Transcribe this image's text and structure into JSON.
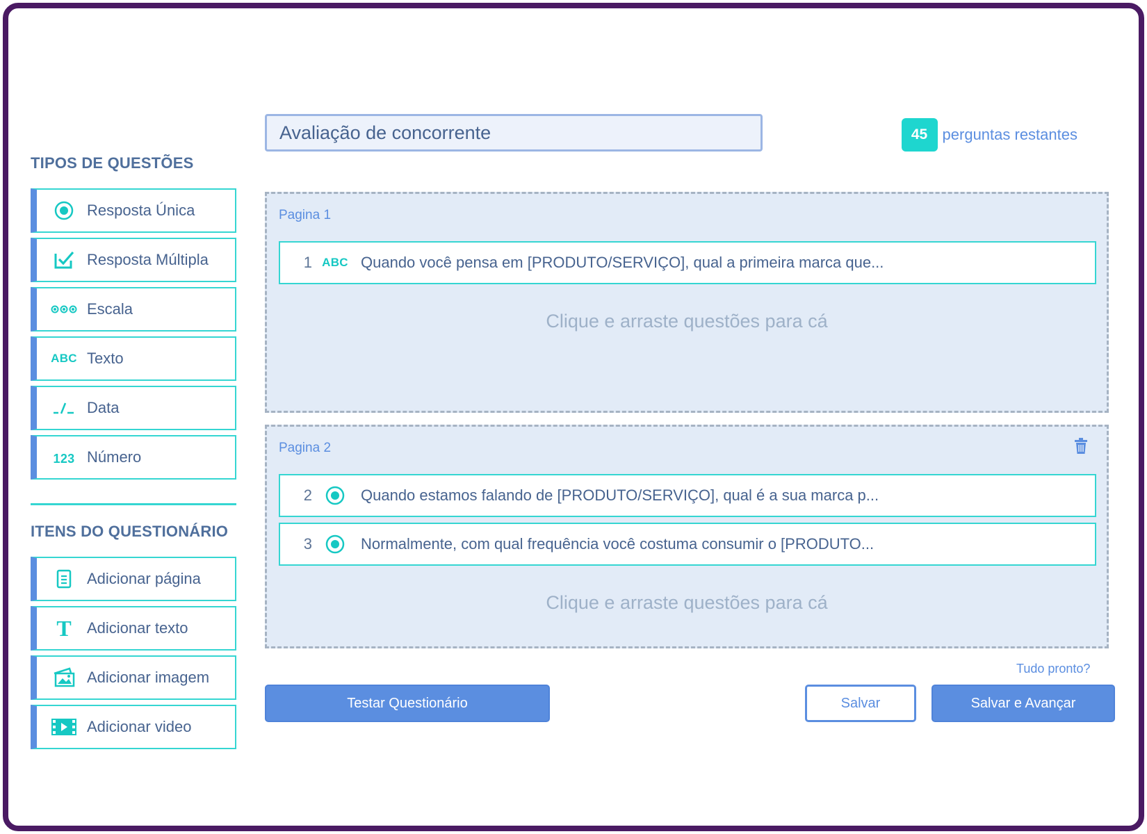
{
  "sidebar": {
    "question_types_title": "TIPOS DE QUESTÕES",
    "question_types": [
      {
        "label": "Resposta Única",
        "icon": "radio-icon"
      },
      {
        "label": "Resposta  Múltipla",
        "icon": "checkbox-icon"
      },
      {
        "label": "Escala",
        "icon": "scale-icon"
      },
      {
        "label": "Texto",
        "icon": "abc-icon",
        "icon_text": "ABC"
      },
      {
        "label": "Data",
        "icon": "date-icon"
      },
      {
        "label": "Número",
        "icon": "number-icon",
        "icon_text": "123"
      }
    ],
    "items_title": "ITENS DO QUESTIONÁRIO",
    "items": [
      {
        "label": "Adicionar página",
        "icon": "page-icon"
      },
      {
        "label": "Adicionar texto",
        "icon": "text-icon",
        "icon_text": "T"
      },
      {
        "label": "Adicionar imagem",
        "icon": "image-icon"
      },
      {
        "label": "Adicionar video",
        "icon": "video-icon"
      }
    ]
  },
  "header": {
    "survey_title": "Avaliação de concorrente",
    "remaining_count": "45",
    "remaining_label": "perguntas restantes"
  },
  "pages": [
    {
      "label": "Pagina 1",
      "questions": [
        {
          "number": "1",
          "icon": "abc-icon",
          "icon_text": "ABC",
          "text": "Quando você pensa em [PRODUTO/SERVIÇO], qual a primeira marca que..."
        }
      ],
      "drop_hint": "Clique e arraste questões para cá"
    },
    {
      "label": "Pagina 2",
      "questions": [
        {
          "number": "2",
          "icon": "radio-icon",
          "text": "Quando estamos falando de [PRODUTO/SERVIÇO], qual é a sua marca p..."
        },
        {
          "number": "3",
          "icon": "radio-icon",
          "text": "Normalmente, com qual frequência você costuma consumir o [PRODUTO..."
        }
      ],
      "drop_hint": "Clique e arraste questões para cá"
    }
  ],
  "footer": {
    "ready_text": "Tudo pronto?",
    "test_label": "Testar Questionário",
    "save_label": "Salvar",
    "save_next_label": "Salvar e Avançar"
  },
  "colors": {
    "frame": "#4a1a63",
    "accent_teal": "#16c8c3",
    "accent_blue": "#5b8ee0",
    "page_bg": "#e2ebf7"
  }
}
